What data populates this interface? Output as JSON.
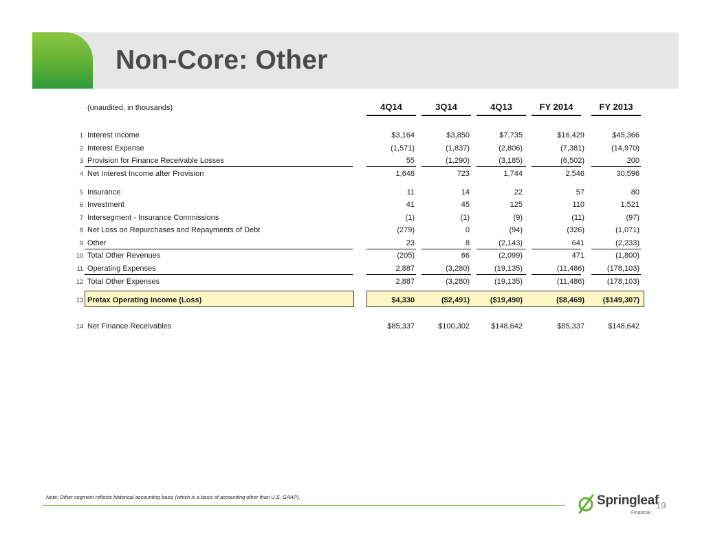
{
  "title": "Non-Core: Other",
  "table": {
    "caption": "(unaudited, in thousands)",
    "columns": [
      "4Q14",
      "3Q14",
      "4Q13",
      "FY 2014",
      "FY 2013"
    ],
    "rows": [
      {
        "num": "1",
        "label": "Interest Income",
        "values": [
          "$3,164",
          "$3,850",
          "$7,735",
          "$16,429",
          "$45,366"
        ]
      },
      {
        "num": "2",
        "label": "Interest Expense",
        "values": [
          "(1,571)",
          "(1,837)",
          "(2,806)",
          "(7,381)",
          "(14,970)"
        ]
      },
      {
        "num": "3",
        "label": "Provision for Finance Receivable Losses",
        "values": [
          "55",
          "(1,290)",
          "(3,185)",
          "(6,502)",
          "200"
        ]
      },
      {
        "num": "4",
        "label": "Net Interest Income after Provision",
        "values": [
          "1,648",
          "723",
          "1,744",
          "2,546",
          "30,596"
        ]
      },
      {
        "num": "5",
        "label": "Insurance",
        "values": [
          "11",
          "14",
          "22",
          "57",
          "80"
        ]
      },
      {
        "num": "6",
        "label": "Investment",
        "values": [
          "41",
          "45",
          "125",
          "110",
          "1,521"
        ]
      },
      {
        "num": "7",
        "label": "Intersegment - Insurance Commissions",
        "values": [
          "(1)",
          "(1)",
          "(9)",
          "(11)",
          "(97)"
        ]
      },
      {
        "num": "8",
        "label": "Net Loss on Repurchases and Repayments of Debt",
        "values": [
          "(279)",
          "0",
          "(94)",
          "(326)",
          "(1,071)"
        ]
      },
      {
        "num": "9",
        "label": "Other",
        "values": [
          "23",
          "8",
          "(2,143)",
          "641",
          "(2,233)"
        ]
      },
      {
        "num": "10",
        "label": "Total Other Revenues",
        "values": [
          "(205)",
          "66",
          "(2,099)",
          "471",
          "(1,800)"
        ]
      },
      {
        "num": "11",
        "label": "Operating Expenses",
        "values": [
          "2,887",
          "(3,280)",
          "(19,135)",
          "(11,486)",
          "(178,103)"
        ]
      },
      {
        "num": "12",
        "label": "Total Other Expenses",
        "values": [
          "2,887",
          "(3,280)",
          "(19,135)",
          "(11,486)",
          "(178,103)"
        ]
      },
      {
        "num": "13",
        "label": "Pretax Operating Income (Loss)",
        "values": [
          "$4,330",
          "($2,491)",
          "($19,490)",
          "($8,469)",
          "($149,307)"
        ],
        "highlight": true
      },
      {
        "num": "14",
        "label": "Net Finance Receivables",
        "values": [
          "$85,337",
          "$100,302",
          "$148,642",
          "$85,337",
          "$148,642"
        ]
      }
    ]
  },
  "footnote": "Note: Other segment reflects historical accounting basis (which is a basis of accounting other than U.S. GAAP).",
  "logo": {
    "wordmark": "Springleaf",
    "subtitle": "Financial"
  },
  "page_number": "19",
  "colors": {
    "accent_green": "#5fb135",
    "banner_gray": "#e6e6e6",
    "highlight_yellow": "#fcf7c5"
  }
}
